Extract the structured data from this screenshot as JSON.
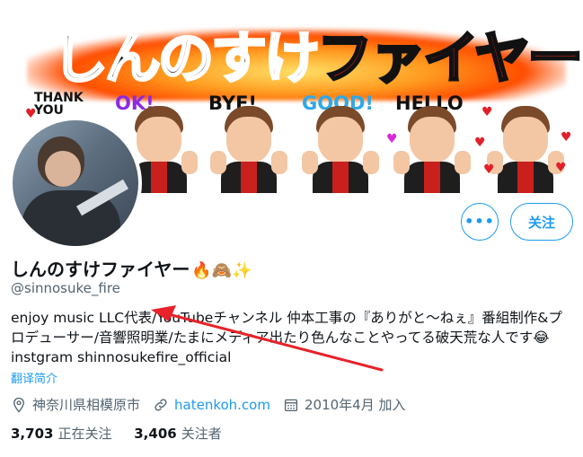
{
  "banner": {
    "title_part1": "しんのすけ",
    "title_part2": "ファイヤー",
    "stickers": [
      "THANK YOU",
      "OK!",
      "BYE!",
      "GOOD!",
      "HELLO"
    ]
  },
  "actions": {
    "more_label": "•••",
    "follow_label": "关注"
  },
  "profile": {
    "name": "しんのすけファイヤー",
    "name_emojis": "🔥🙈✨",
    "handle": "@sinnosuke_fire",
    "bio": "enjoy music LLC代表/YouTubeチャンネル 仲本工事の『ありがと〜ねぇ』番組制作&プロデューサー/音響照明業/たまにメディア出たり色んなことやってる破天荒な人です😂instgram shinnosukefire_official",
    "translate": "翻译简介",
    "location": "神奈川県相模原市",
    "website": "hatenkoh.com",
    "joined": "2010年4月 加入",
    "following_count": "3,703",
    "following_label": "正在关注",
    "followers_count": "3,406",
    "followers_label": "关注者"
  },
  "colors": {
    "accent": "#1d9bf0",
    "muted": "#536471",
    "annotation": "#e8222a"
  },
  "icons": [
    "location-pin-icon",
    "link-icon",
    "calendar-icon",
    "more-icon"
  ]
}
